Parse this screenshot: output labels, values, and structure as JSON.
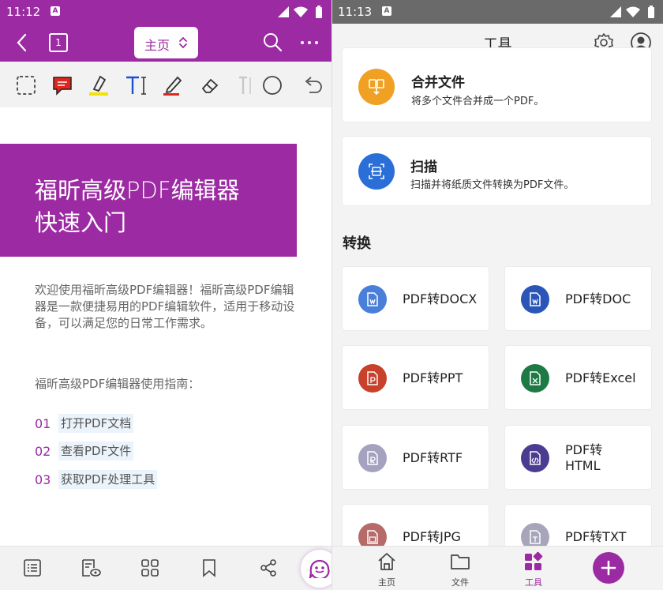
{
  "left": {
    "status": {
      "time": "11:12",
      "badge": "A"
    },
    "topbar": {
      "page_number": "1",
      "home_label": "主页"
    },
    "banner": {
      "line1": "福昕高级PDF编辑器",
      "line2": "快速入门"
    },
    "intro": "欢迎使用福昕高级PDF编辑器！福昕高级PDF编辑器是一款便捷易用的PDF编辑软件，适用于移动设备，可以满足您的日常工作需求。",
    "guide_title": "福昕高级PDF编辑器使用指南：",
    "steps": [
      {
        "num": "01",
        "text": "打开PDF文档"
      },
      {
        "num": "02",
        "text": "查看PDF文件"
      },
      {
        "num": "03",
        "text": "获取PDF处理工具"
      }
    ]
  },
  "right": {
    "status": {
      "time": "11:13",
      "badge": "A"
    },
    "header": {
      "title": "工具"
    },
    "merge": {
      "title": "合并文件",
      "desc": "将多个文件合并成一个PDF。"
    },
    "scan": {
      "title": "扫描",
      "desc": "扫描并将纸质文件转换为PDF文件。"
    },
    "section": "转换",
    "convert": [
      {
        "line1": "PDF转DOCX",
        "line2": ""
      },
      {
        "line1": "PDF转DOC",
        "line2": ""
      },
      {
        "line1": "PDF转PPT",
        "line2": ""
      },
      {
        "line1": "PDF转Excel",
        "line2": ""
      },
      {
        "line1": "PDF转RTF",
        "line2": ""
      },
      {
        "line1": "PDF转",
        "line2": "HTML"
      },
      {
        "line1": "PDF转JPG",
        "line2": ""
      },
      {
        "line1": "PDF转TXT",
        "line2": ""
      }
    ],
    "nav": {
      "home": "主页",
      "files": "文件",
      "tools": "工具"
    }
  },
  "colors": {
    "brand": "#9c2aa3",
    "merge": "#f0a022",
    "scan": "#2a6ed8",
    "docx": "#4a7fd9",
    "doc": "#2b56b8",
    "ppt": "#c8412a",
    "excel": "#1e7a44",
    "rtf": "#a5a2c0",
    "html": "#4b3c92",
    "jpg": "#b66a6a",
    "txt": "#a7a5ba"
  }
}
